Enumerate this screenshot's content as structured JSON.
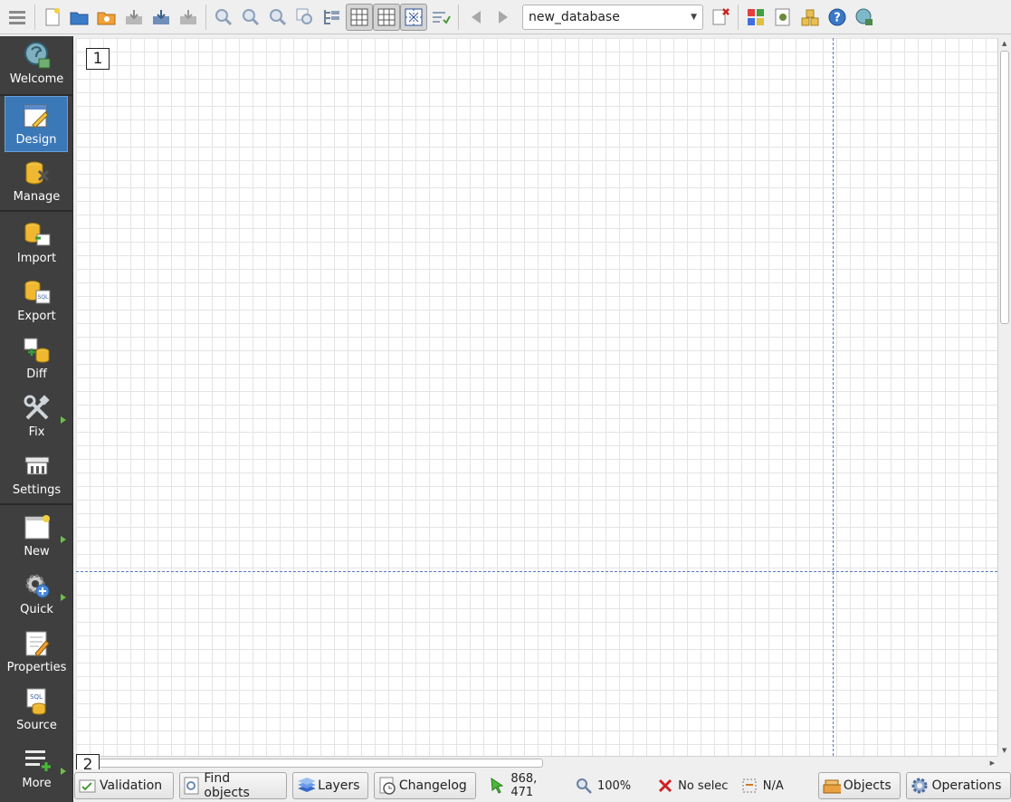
{
  "toolbar": {
    "database_selector": "new_database"
  },
  "sidebar": {
    "items": [
      {
        "label": "Welcome"
      },
      {
        "label": "Design"
      },
      {
        "label": "Manage"
      },
      {
        "label": "Import"
      },
      {
        "label": "Export"
      },
      {
        "label": "Diff"
      },
      {
        "label": "Fix"
      },
      {
        "label": "Settings"
      },
      {
        "label": "New"
      },
      {
        "label": "Quick"
      },
      {
        "label": "Properties"
      },
      {
        "label": "Source"
      },
      {
        "label": "More"
      }
    ]
  },
  "canvas": {
    "tag_1": "1",
    "tag_2": "2"
  },
  "statusbar": {
    "validation": "Validation",
    "find_objects": "Find objects",
    "layers": "Layers",
    "changelog": "Changelog",
    "cursor_position": "868, 471",
    "zoom": "100%",
    "selection": "No selecti",
    "selection_size": "N/A",
    "objects": "Objects",
    "operations": "Operations"
  },
  "colors": {
    "sidebar_bg": "#3f3f3f",
    "sidebar_active": "#3b78b8",
    "guide_line": "#5a78c0"
  }
}
